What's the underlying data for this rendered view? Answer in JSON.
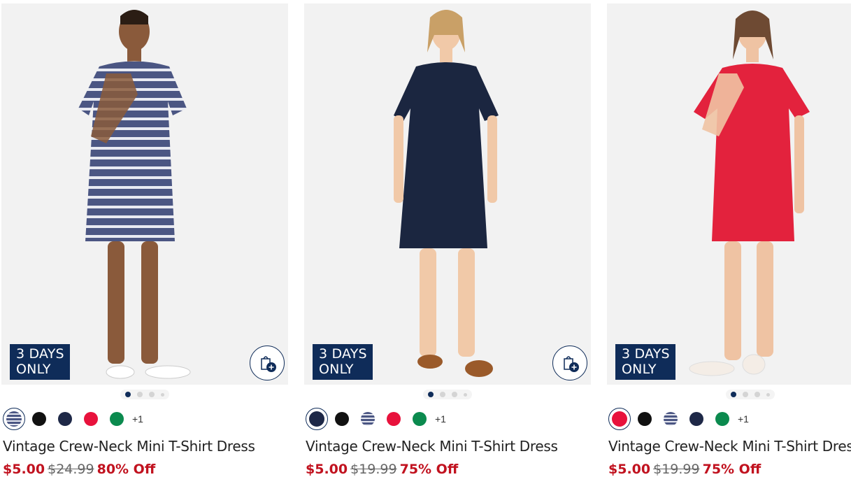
{
  "products": [
    {
      "badge": [
        "3 DAYS",
        "ONLY"
      ],
      "title": "Vintage Crew-Neck Mini T-Shirt Dress",
      "sale_price": "$5.00",
      "original_price": "$24.99",
      "discount": "80% Off",
      "more_colors": "+1",
      "dress_color": "#4b5683",
      "swatches": [
        "stripe-navy",
        "black",
        "navy",
        "red",
        "green"
      ]
    },
    {
      "badge": [
        "3 DAYS",
        "ONLY"
      ],
      "title": "Vintage Crew-Neck Mini T-Shirt Dress",
      "sale_price": "$5.00",
      "original_price": "$19.99",
      "discount": "75% Off",
      "more_colors": "+1",
      "dress_color": "#1b2640",
      "swatches": [
        "navy",
        "black",
        "stripe-navy",
        "red",
        "green"
      ]
    },
    {
      "badge": [
        "3 DAYS",
        "ONLY"
      ],
      "title": "Vintage Crew-Neck Mini T-Shirt Dress",
      "sale_price": "$5.00",
      "original_price": "$19.99",
      "discount": "75% Off",
      "more_colors": "+1",
      "dress_color": "#e3223d",
      "swatches": [
        "red",
        "black",
        "stripe-navy",
        "navy",
        "green"
      ]
    }
  ],
  "colors": {
    "badge_bg": "#0f2c59",
    "sale": "#c1121f",
    "black": "#111111",
    "navy": "#1e2847",
    "red": "#e8123c",
    "green": "#0b8a4e"
  }
}
